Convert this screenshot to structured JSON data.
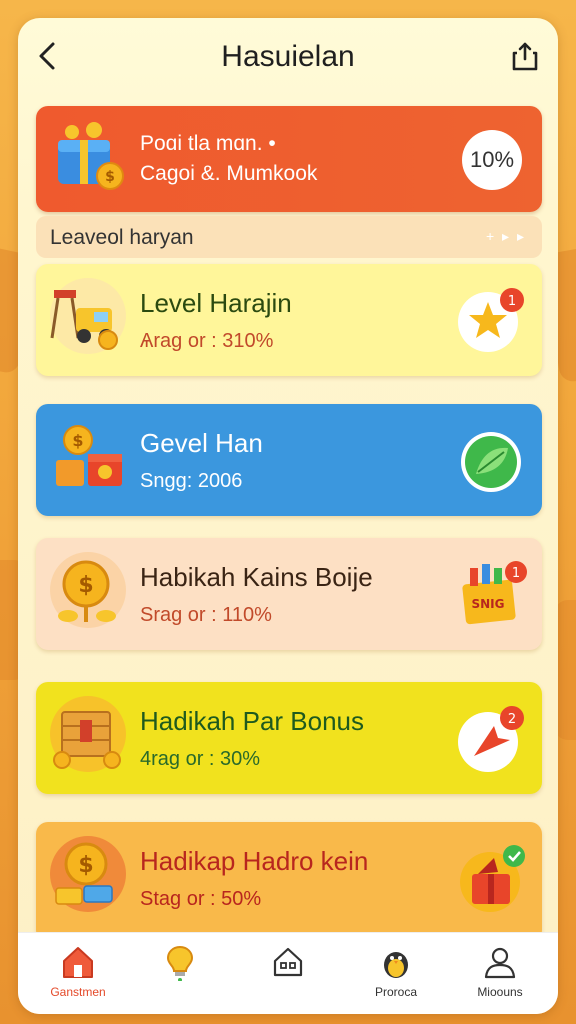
{
  "header": {
    "title": "Haѕuielan"
  },
  "banner": {
    "line1": "Poɑi tla mɑn. •",
    "line2": "Cagoi &. Mumkook",
    "badge": "10%"
  },
  "section": {
    "label": "Leaveol haryan",
    "more": "+ ▸ ▸"
  },
  "cards": [
    {
      "title": "Level Harajin",
      "subtitle": "Ѧrag or : 310%"
    },
    {
      "title": "Gevel Han",
      "subtitle": "Sngg: 2006"
    },
    {
      "title": "Habikah Kains Boije",
      "subtitle": "Srag or : 110%"
    },
    {
      "title": "Hadikah Par Bonus",
      "subtitle": "4rag or : 30%"
    },
    {
      "title": "Hadikap Hadro kein",
      "subtitle": "Stag or : 50%"
    }
  ],
  "badges": {
    "card1_count": "1",
    "card3_count": "1",
    "card3_text": "SNIG",
    "card4_count": "2"
  },
  "tabs": [
    {
      "label": "Ganstmen",
      "icon": "home-icon"
    },
    {
      "label": "",
      "icon": "lightbulb-icon"
    },
    {
      "label": "",
      "icon": "house-outline-icon"
    },
    {
      "label": "Proroca",
      "icon": "penguin-icon"
    },
    {
      "label": "Mioouns",
      "icon": "user-icon"
    }
  ],
  "colors": {
    "accent": "#ef5a2e",
    "card_blue": "#3b97de",
    "card_yellow": "#f1e21e"
  }
}
